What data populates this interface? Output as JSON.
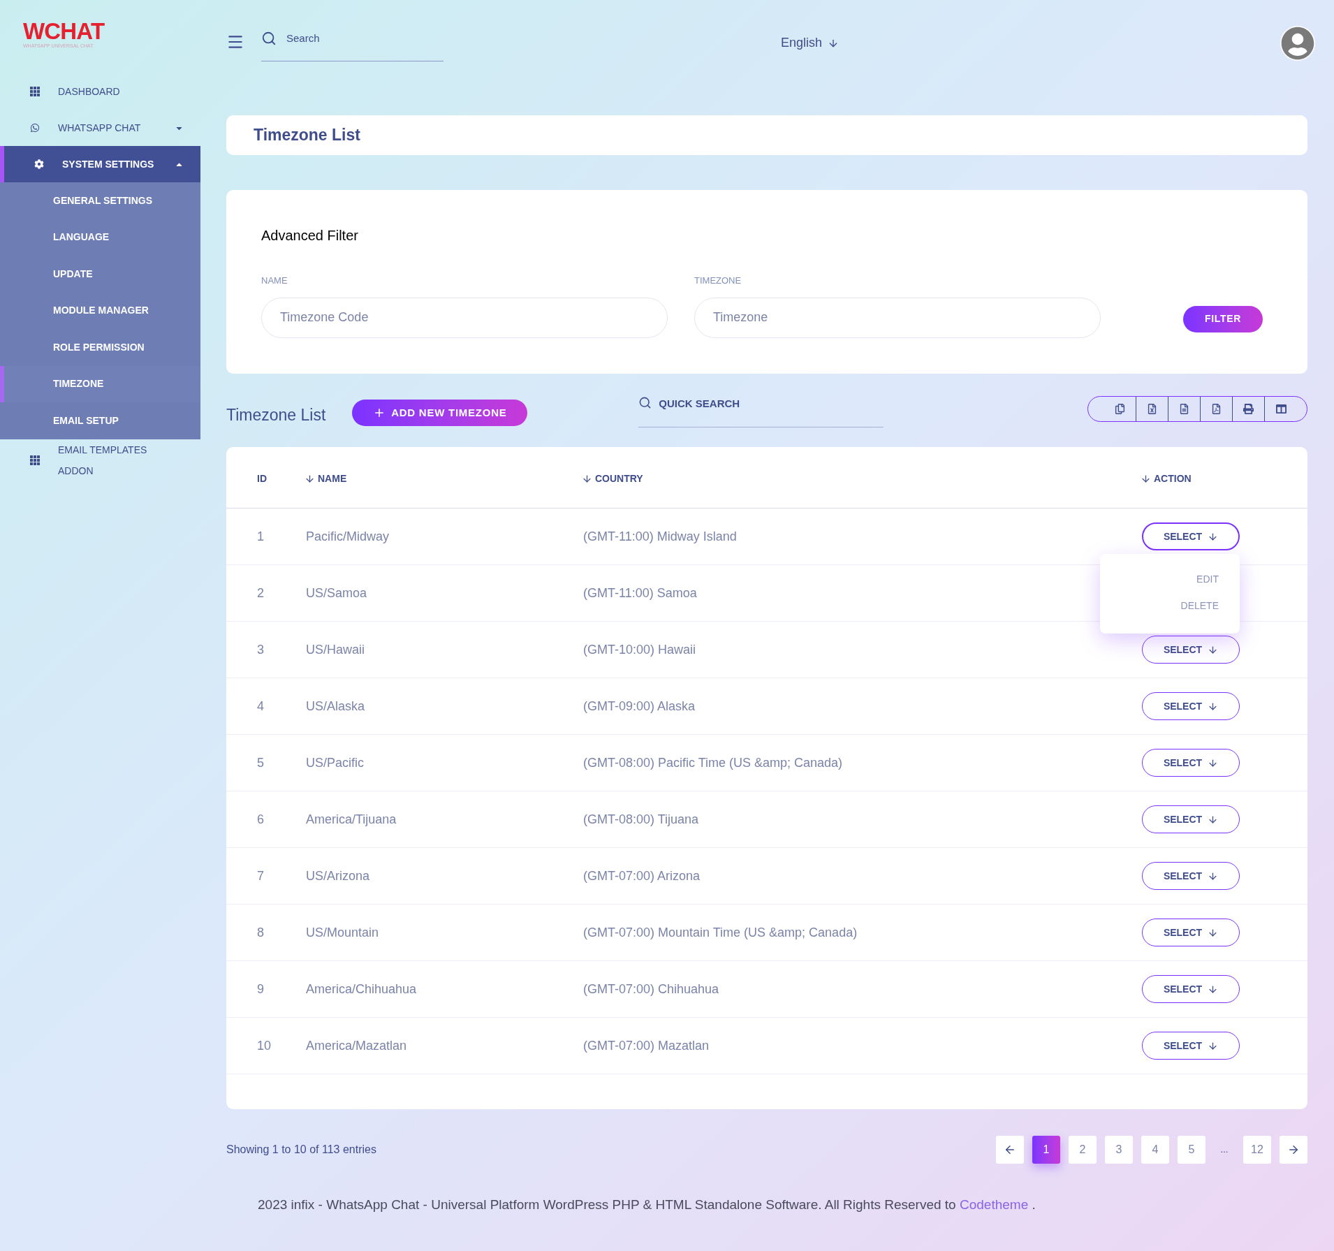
{
  "sidebar": {
    "logo": {
      "title": "WCHAT",
      "subtitle": "WHATSAPP UNIVERSAL CHAT"
    },
    "items": [
      {
        "kind": "grid",
        "label": "DASHBOARD",
        "selected": false
      },
      {
        "kind": "whatsapp",
        "label": "WHATSAPP CHAT",
        "selected": false,
        "expanded": false
      },
      {
        "kind": "gear",
        "label": "SYSTEM SETTINGS",
        "selected": true,
        "expanded": true,
        "children": [
          {
            "label": "GENERAL SETTINGS",
            "selected": false
          },
          {
            "label": "LANGUAGE",
            "selected": false
          },
          {
            "label": "UPDATE",
            "selected": false
          },
          {
            "label": "MODULE MANAGER",
            "selected": false
          },
          {
            "label": "ROLE PERMISSION",
            "selected": false
          },
          {
            "label": "TIMEZONE",
            "selected": true
          },
          {
            "label": "EMAIL SETUP",
            "selected": false
          }
        ]
      },
      {
        "kind": "grid",
        "label": "EMAIL TEMPLATES ADDON",
        "selected": false
      }
    ]
  },
  "header": {
    "search": {
      "placeholder": "Search"
    },
    "language": "English"
  },
  "page_title": "Timezone List",
  "filter": {
    "title": "Advanced Filter",
    "fields": [
      {
        "label": "NAME",
        "placeholder": "Timezone Code"
      },
      {
        "label": "TIMEZONE",
        "placeholder": "Timezone"
      }
    ],
    "button": "FILTER"
  },
  "list": {
    "title": "Timezone List",
    "add_button": "ADD NEW TIMEZONE",
    "quick_search": {
      "placeholder": "QUICK SEARCH"
    },
    "table": {
      "columns": [
        {
          "label": "ID",
          "sortable": false
        },
        {
          "label": "NAME",
          "sortable": true
        },
        {
          "label": "COUNTRY",
          "sortable": true
        },
        {
          "label": "ACTION",
          "sortable": true
        }
      ],
      "rows": [
        {
          "id": "1",
          "name": "Pacific/Midway",
          "country": "(GMT-11:00) Midway Island",
          "action": "SELECT",
          "menu": {
            "items": [
              "EDIT",
              "DELETE"
            ]
          }
        },
        {
          "id": "2",
          "name": "US/Samoa",
          "country": "(GMT-11:00) Samoa"
        },
        {
          "id": "3",
          "name": "US/Hawaii",
          "country": "(GMT-10:00) Hawaii",
          "action": "SELECT"
        },
        {
          "id": "4",
          "name": "US/Alaska",
          "country": "(GMT-09:00) Alaska",
          "action": "SELECT"
        },
        {
          "id": "5",
          "name": "US/Pacific",
          "country": "(GMT-08:00) Pacific Time (US &amp; Canada)",
          "action": "SELECT"
        },
        {
          "id": "6",
          "name": "America/Tijuana",
          "country": "(GMT-08:00) Tijuana",
          "action": "SELECT"
        },
        {
          "id": "7",
          "name": "US/Arizona",
          "country": "(GMT-07:00) Arizona",
          "action": "SELECT"
        },
        {
          "id": "8",
          "name": "US/Mountain",
          "country": "(GMT-07:00) Mountain Time (US &amp; Canada)",
          "action": "SELECT"
        },
        {
          "id": "9",
          "name": "America/Chihuahua",
          "country": "(GMT-07:00) Chihuahua",
          "action": "SELECT"
        },
        {
          "id": "10",
          "name": "America/Mazatlan",
          "country": "(GMT-07:00) Mazatlan",
          "action": "SELECT"
        }
      ]
    }
  },
  "pagination": {
    "info": "Showing 1 to 10 of 113 entries",
    "pages": [
      {
        "kind": "page",
        "label": "1",
        "selected": true
      },
      {
        "kind": "page",
        "label": "2",
        "selected": false
      },
      {
        "kind": "page",
        "label": "3",
        "selected": false
      },
      {
        "kind": "page",
        "label": "4",
        "selected": false
      },
      {
        "kind": "page",
        "label": "5",
        "selected": false
      },
      {
        "kind": "ellipsis",
        "label": "..."
      },
      {
        "kind": "page",
        "label": "12",
        "selected": false
      }
    ]
  },
  "footer": {
    "text": "2023 infix - WhatsApp Chat - Universal Platform WordPress PHP & HTML Standalone Software. All Rights Reserved to",
    "link": "Codetheme",
    "end": "."
  }
}
